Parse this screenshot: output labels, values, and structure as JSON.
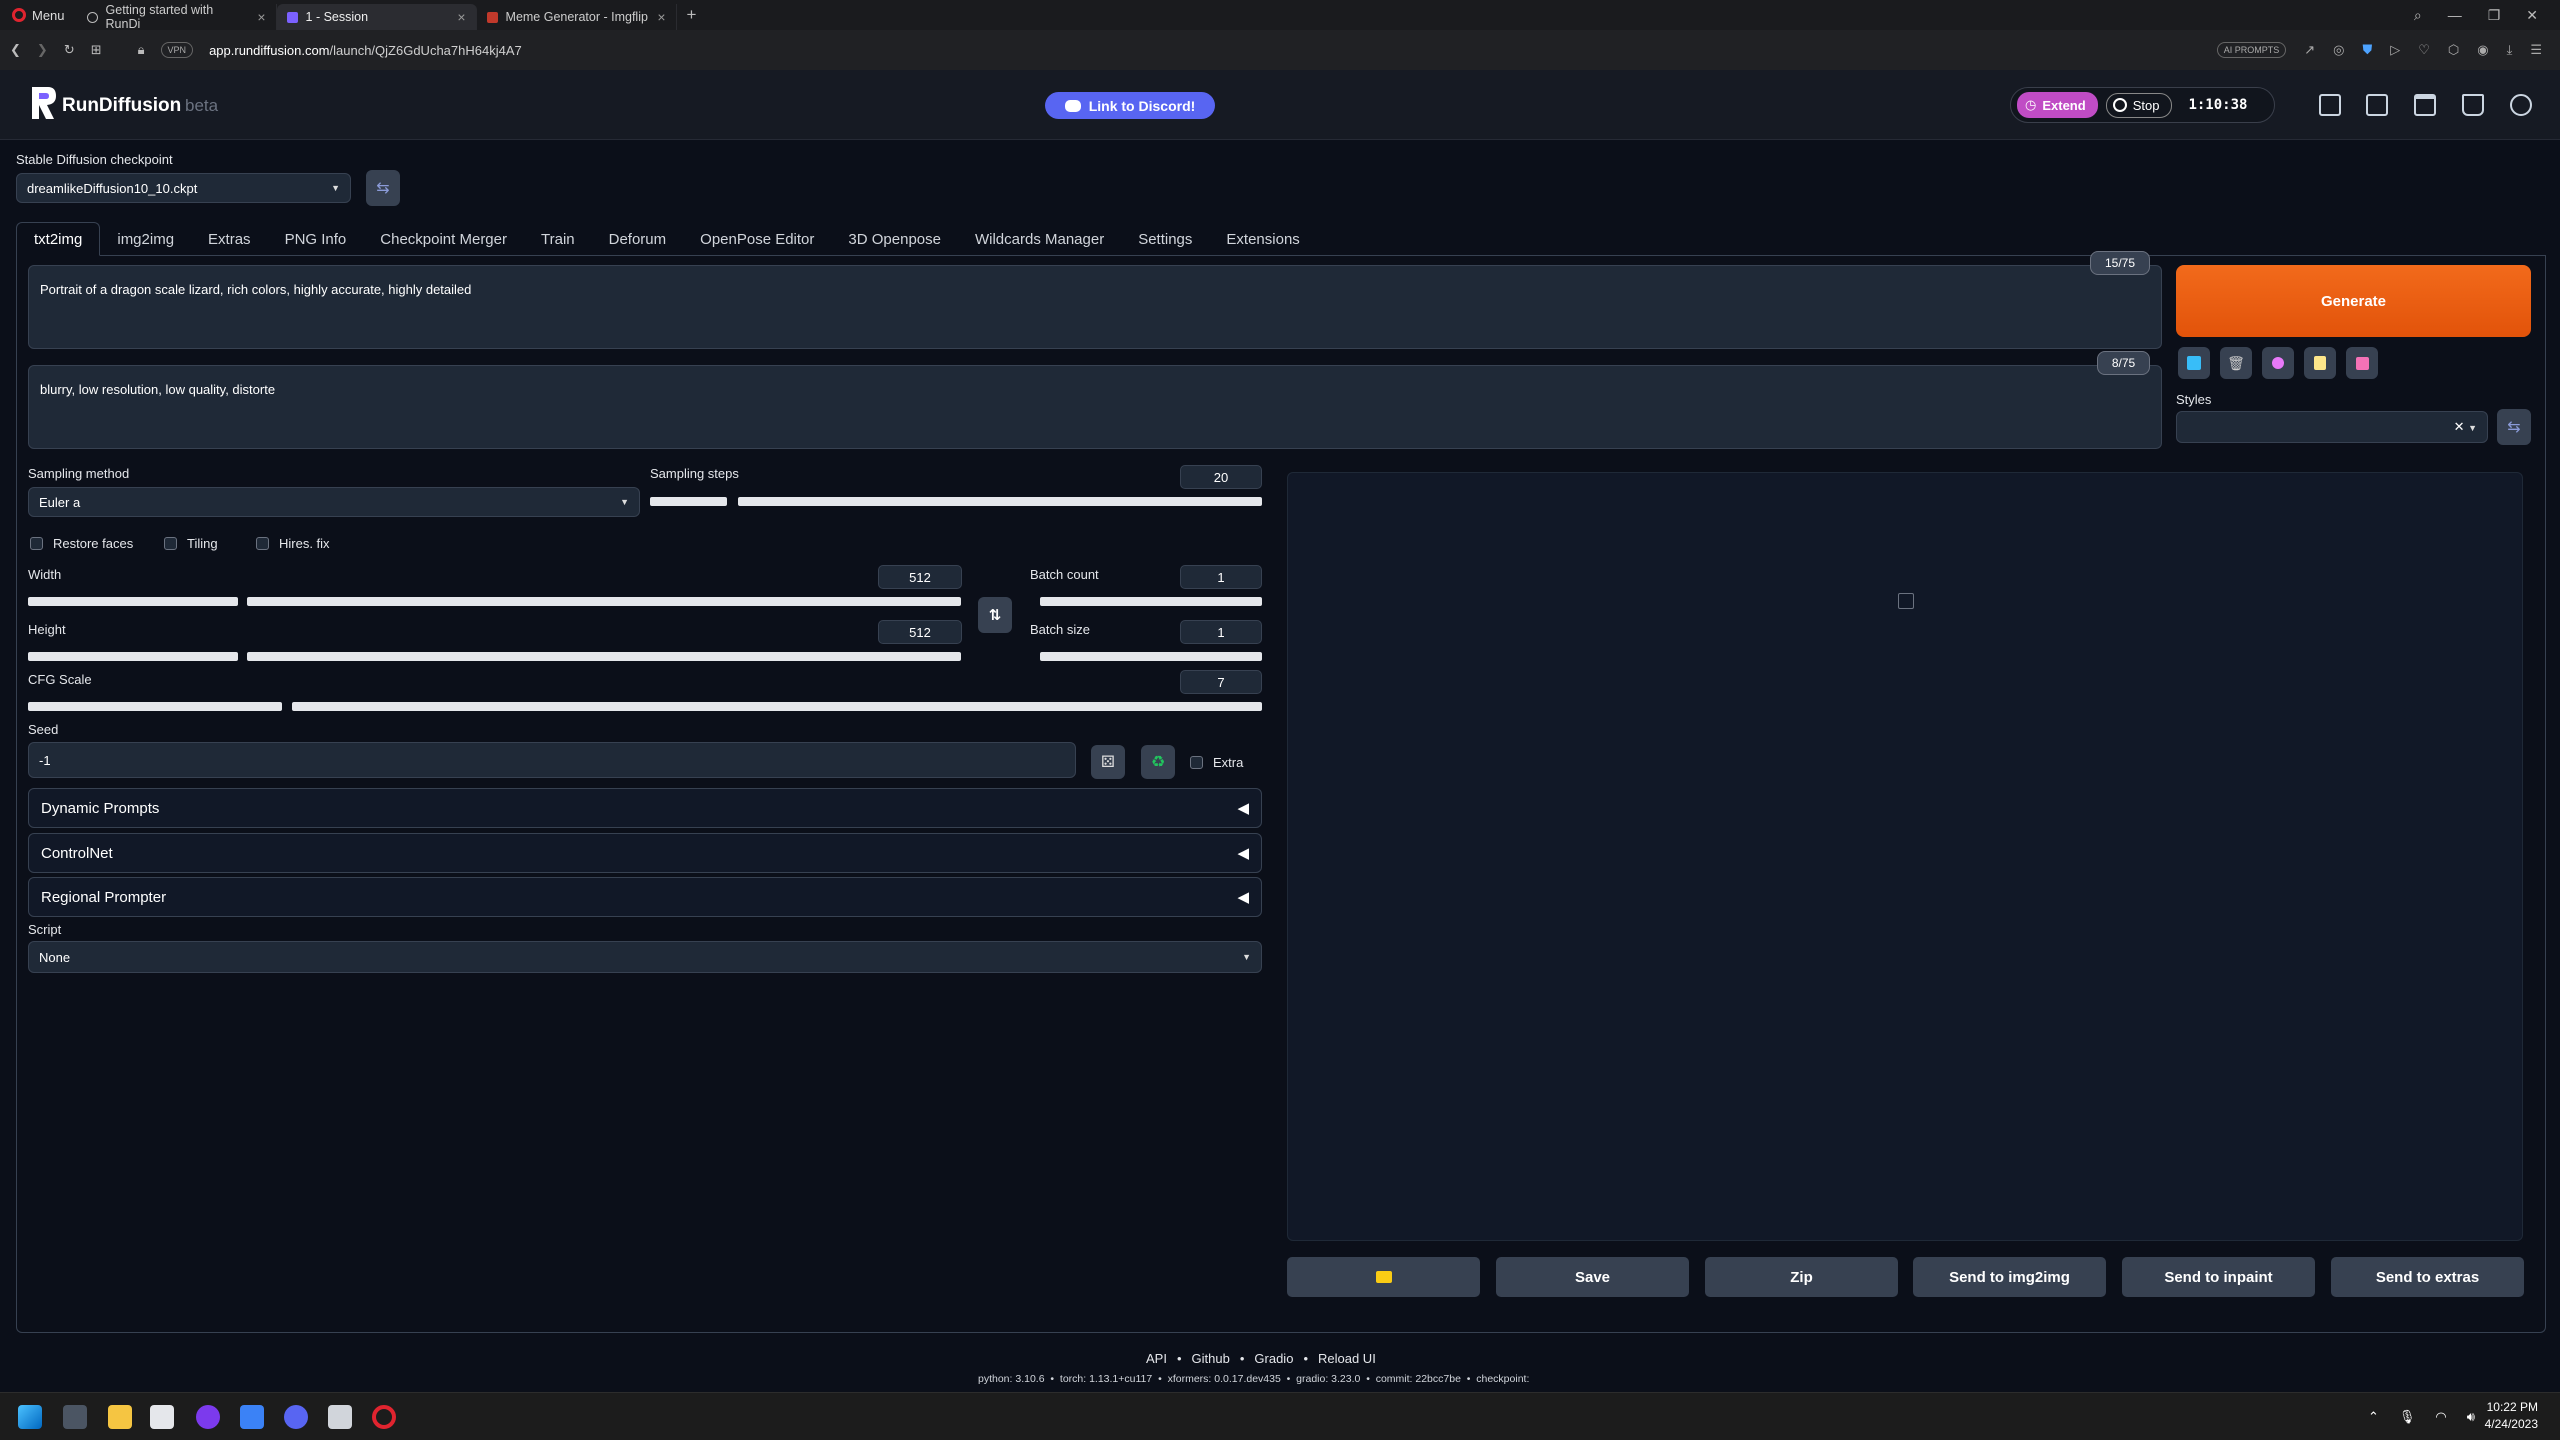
{
  "browser": {
    "menu_label": "Menu",
    "tabs": [
      {
        "title": "Getting started with RunDi",
        "icon": "globe-icon"
      },
      {
        "title": "1 - Session",
        "icon": "rundiffusion-icon"
      },
      {
        "title": "Meme Generator - Imgflip",
        "icon": "imgflip-icon"
      }
    ],
    "new_tab": "+",
    "close_glyph": "×",
    "url_host": "app.rundiffusion.com",
    "url_path": "/launch/QjZ6GdUcha7hH64kj4A7",
    "ai_prompts_badge": "AI PROMPTS",
    "vpn_badge": "VPN"
  },
  "header": {
    "logo_text": "RunDiffusion",
    "beta_label": "beta",
    "discord_button": "Link to Discord!",
    "extend_button": "Extend",
    "stop_button": "Stop",
    "timer": "1:10:38"
  },
  "checkpoint": {
    "label": "Stable Diffusion checkpoint",
    "value": "dreamlikeDiffusion10_10.ckpt"
  },
  "tabs": [
    "txt2img",
    "img2img",
    "Extras",
    "PNG Info",
    "Checkpoint Merger",
    "Train",
    "Deforum",
    "OpenPose Editor",
    "3D Openpose",
    "Wildcards Manager",
    "Settings",
    "Extensions"
  ],
  "prompt": {
    "positive": "Portrait of a dragon scale lizard, rich colors, highly accurate, highly detailed",
    "positive_count": "15/75",
    "negative": "blurry, low resolution, low quality, distorte",
    "negative_count": "8/75"
  },
  "generate_label": "Generate",
  "styles_label": "Styles",
  "sampling": {
    "method_label": "Sampling method",
    "method_value": "Euler a",
    "steps_label": "Sampling steps",
    "steps_value": "20"
  },
  "checkboxes": {
    "restore_faces": "Restore faces",
    "tiling": "Tiling",
    "hires_fix": "Hires. fix"
  },
  "dims": {
    "width_label": "Width",
    "width_value": "512",
    "height_label": "Height",
    "height_value": "512",
    "batch_count_label": "Batch count",
    "batch_count_value": "1",
    "batch_size_label": "Batch size",
    "batch_size_value": "1",
    "cfg_label": "CFG Scale",
    "cfg_value": "7"
  },
  "seed": {
    "label": "Seed",
    "value": "-1",
    "extra_label": "Extra"
  },
  "accordions": [
    "Dynamic Prompts",
    "ControlNet",
    "Regional Prompter"
  ],
  "script": {
    "label": "Script",
    "value": "None"
  },
  "output_buttons": [
    "Save",
    "Zip",
    "Send to img2img",
    "Send to inpaint",
    "Send to extras"
  ],
  "footer": {
    "links": [
      "API",
      "Github",
      "Gradio",
      "Reload UI"
    ],
    "info": "python: 3.10.6  •  torch: 1.13.1+cu117  •  xformers: 0.0.17.dev435  •  gradio: 3.23.0  •  commit: 22bcc7be  •  checkpoint:"
  },
  "taskbar": {
    "time": "10:22 PM",
    "date": "4/24/2023"
  },
  "colors": {
    "background": "#0b0f19",
    "accent_generate": "#ea580c",
    "discord": "#5865f2",
    "extend": "#c04cc5"
  }
}
